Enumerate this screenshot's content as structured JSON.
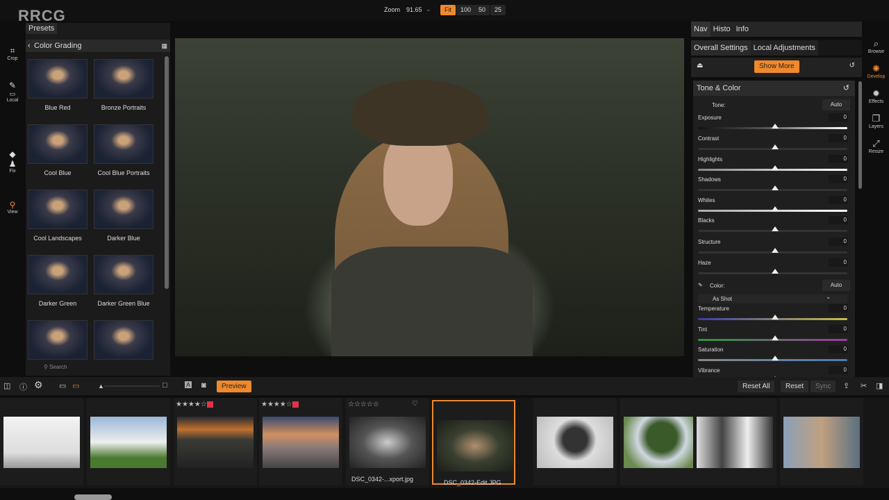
{
  "top": {
    "zoom_label": "Zoom",
    "zoom_value": "91.65",
    "zoom_options": [
      "Fit",
      "100",
      "50",
      "25"
    ],
    "active": "Fit"
  },
  "watermark": "RRCG",
  "tools": [
    {
      "label": "Crop",
      "icon": "crop-icon"
    },
    {
      "label": "Local",
      "icon": "brush-icon"
    },
    {
      "label": "Fix",
      "icon": "stamp-icon"
    },
    {
      "label": "View",
      "icon": "zoom-icon"
    }
  ],
  "presets": {
    "tab": "Presets",
    "category": "Color Grading",
    "search": "Search",
    "items": [
      "Blue Red",
      "Bronze Portraits",
      "Cool Blue",
      "Cool Blue Portraits",
      "Cool Landscapes",
      "Darker Blue",
      "Darker Green",
      "Darker Green Blue",
      "",
      ""
    ]
  },
  "right": {
    "tabs": [
      "Nav",
      "Histo",
      "Info"
    ],
    "subtabs": [
      "Overall Settings",
      "Local Adjustments"
    ],
    "show_more": "Show More",
    "section": "Tone & Color",
    "tone_label": "Tone:",
    "auto": "Auto",
    "tone_sliders": [
      {
        "label": "Exposure",
        "value": "0"
      },
      {
        "label": "Contrast",
        "value": "0"
      },
      {
        "label": "Highlights",
        "value": "0"
      },
      {
        "label": "Shadows",
        "value": "0"
      },
      {
        "label": "Whites",
        "value": "0"
      },
      {
        "label": "Blacks",
        "value": "0"
      },
      {
        "label": "Structure",
        "value": "0"
      },
      {
        "label": "Haze",
        "value": "0"
      }
    ],
    "color_label": "Color:",
    "color_auto": "Auto",
    "wb": "As Shot",
    "color_sliders": [
      {
        "label": "Temperature",
        "value": "0"
      },
      {
        "label": "Tint",
        "value": "0"
      },
      {
        "label": "Saturation",
        "value": "0"
      },
      {
        "label": "Vibrance",
        "value": "0"
      }
    ]
  },
  "rail": [
    {
      "label": "Browse"
    },
    {
      "label": "Develop"
    },
    {
      "label": "Effects"
    },
    {
      "label": "Layers"
    },
    {
      "label": "Resize"
    }
  ],
  "accent": "#f0892c",
  "bottom": {
    "preview": "Preview",
    "reset_all": "Reset All",
    "reset": "Reset",
    "sync": "Sync"
  },
  "film": [
    {
      "stars": "",
      "name": ""
    },
    {
      "stars": "",
      "name": ""
    },
    {
      "stars": "★★★★☆",
      "flag": true,
      "name": ""
    },
    {
      "stars": "★★★★☆",
      "flag": true,
      "name": ""
    },
    {
      "stars": "☆☆☆☆☆",
      "name": "DSC_0342-...xport.jpg"
    },
    {
      "stars": "",
      "name": "DSC_0342-Edit.JPG",
      "selected": true
    },
    {
      "stars": "",
      "name": ""
    },
    {
      "stars": "",
      "name": ""
    },
    {
      "stars": "",
      "name": ""
    },
    {
      "stars": "",
      "name": ""
    }
  ]
}
